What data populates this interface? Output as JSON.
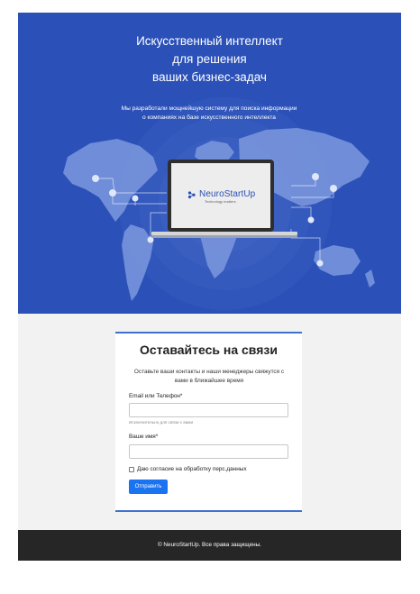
{
  "hero": {
    "title_lines": [
      "Искусственный интеллект",
      "для решения",
      "ваших бизнес-задач"
    ],
    "subtitle": "Мы разработали мощнейшую систему для поиска информации о компаниях на базе искусственного интеллекта",
    "brand_name": "NeuroStartUp",
    "brand_tagline": "Technology matters",
    "colors": {
      "background": "#2b51b8",
      "brand": "#2a4fb5"
    }
  },
  "contact": {
    "title": "Оставайтесь на связи",
    "description": "Оставьте ваши контакты и наши менеджеры свяжутся с вами в ближайшее время",
    "email_label": "Email или Телефон*",
    "email_value": "",
    "email_hint": "Исключительно для связи с вами",
    "name_label": "Ваше имя*",
    "name_value": "",
    "consent_label": "Даю согласие на обработку перс.данных",
    "consent_checked": false,
    "submit_label": "Отправить",
    "colors": {
      "accent": "#3f6fd1",
      "button": "#1a73f0"
    }
  },
  "footer": {
    "text": "© NeuroStartUp. Все права защищены."
  }
}
